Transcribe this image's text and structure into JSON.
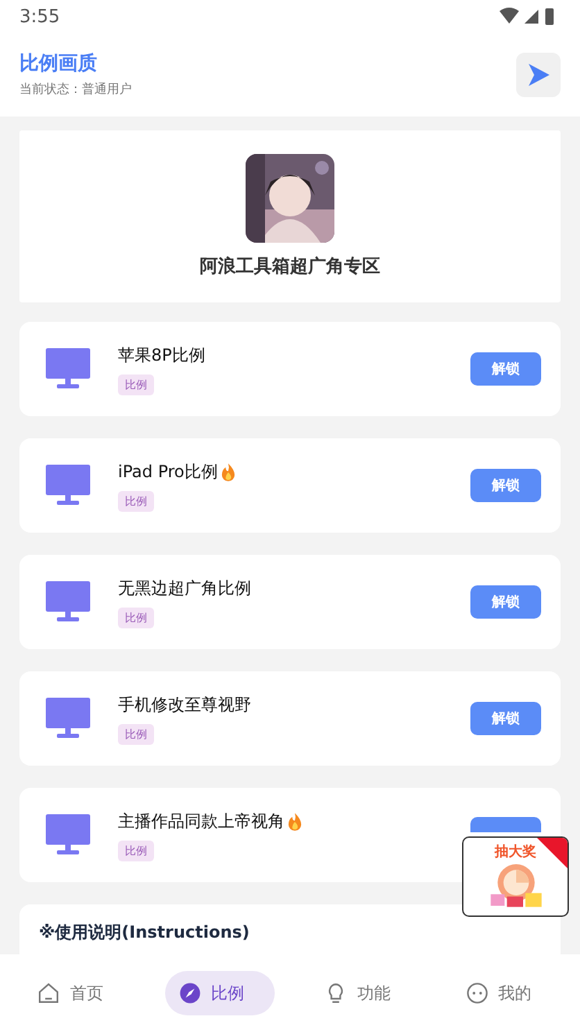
{
  "status_bar": {
    "time": "3:55"
  },
  "header": {
    "title": "比例画质",
    "subtitle": "当前状态：普通用户"
  },
  "profile": {
    "name": "阿浪工具箱超广角专区"
  },
  "items": [
    {
      "title": "苹果8P比例",
      "hot": false,
      "tag": "比例",
      "button": "解锁"
    },
    {
      "title": "iPad Pro比例",
      "hot": true,
      "tag": "比例",
      "button": "解锁"
    },
    {
      "title": "无黑边超广角比例",
      "hot": false,
      "tag": "比例",
      "button": "解锁"
    },
    {
      "title": "手机修改至尊视野",
      "hot": false,
      "tag": "比例",
      "button": "解锁"
    },
    {
      "title": "主播作品同款上帝视角",
      "hot": true,
      "tag": "比例"
    }
  ],
  "instructions": {
    "title": "※使用说明(Instructions)"
  },
  "promo": {
    "title": "抽大奖"
  },
  "nav": [
    {
      "label": "首页",
      "kind": "home",
      "selected": false
    },
    {
      "label": "比例",
      "kind": "compass",
      "selected": true
    },
    {
      "label": "功能",
      "kind": "bulb",
      "selected": false
    },
    {
      "label": "我的",
      "kind": "face",
      "selected": false
    }
  ]
}
